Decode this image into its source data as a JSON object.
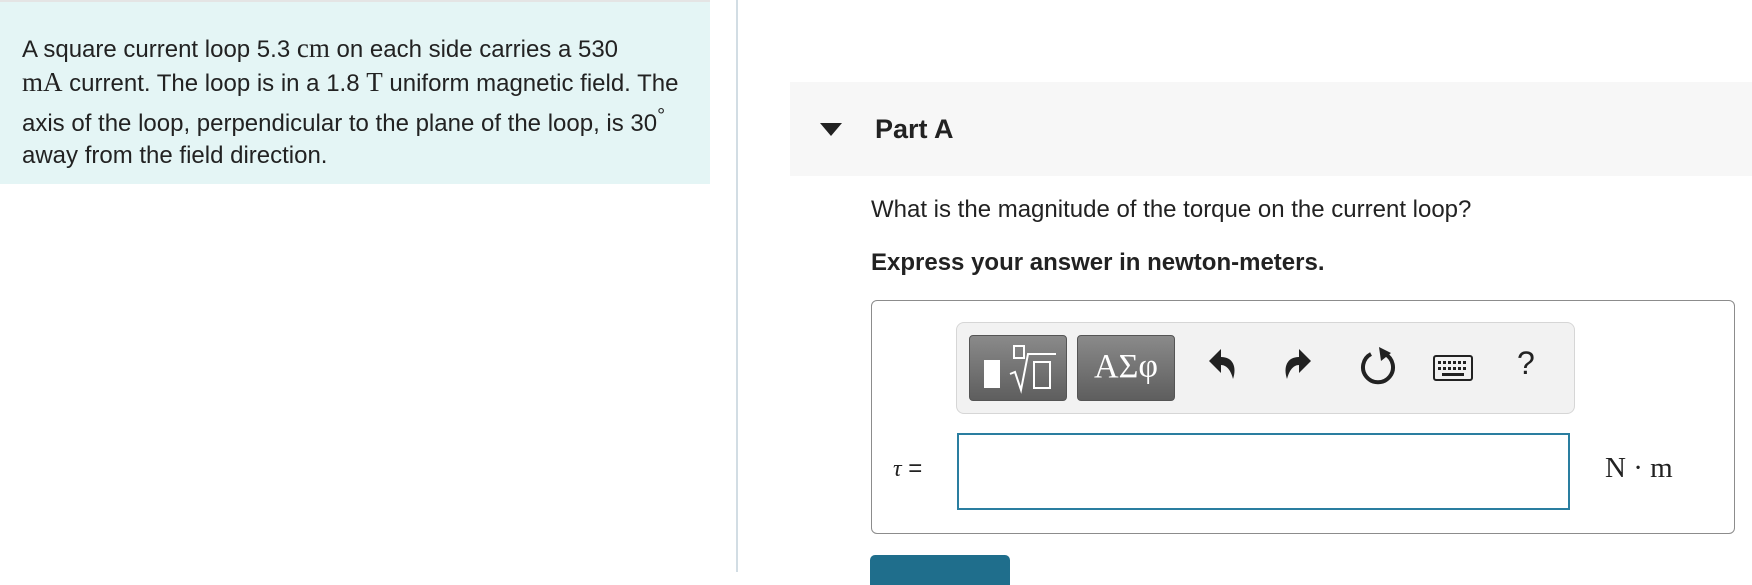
{
  "problem": {
    "p1": "A square current loop 5.3 ",
    "u1": "cm",
    "p2": " on each side carries a 530",
    "u2": "mA",
    "p3": " current. The loop is in a 1.8 ",
    "u3": "T",
    "p4": " uniform magnetic field. The axis of the loop, perpendicular to the plane of the loop, is 30",
    "deg": "°",
    "p5": "  away from the field direction."
  },
  "part": {
    "title": "Part A"
  },
  "question": "What is the magnitude of the torque on the current loop?",
  "instruction": "Express your answer in newton-meters.",
  "toolbar": {
    "symbols_label": "ΑΣφ",
    "help_label": "?"
  },
  "answer": {
    "variable": "τ",
    "equals": " =",
    "value": "",
    "unit": "N · m"
  },
  "submit": {
    "label": ""
  },
  "colors": {
    "problem_bg": "#e4f5f5",
    "input_border": "#2a7ea0",
    "submit_bg": "#1f6e8c"
  }
}
